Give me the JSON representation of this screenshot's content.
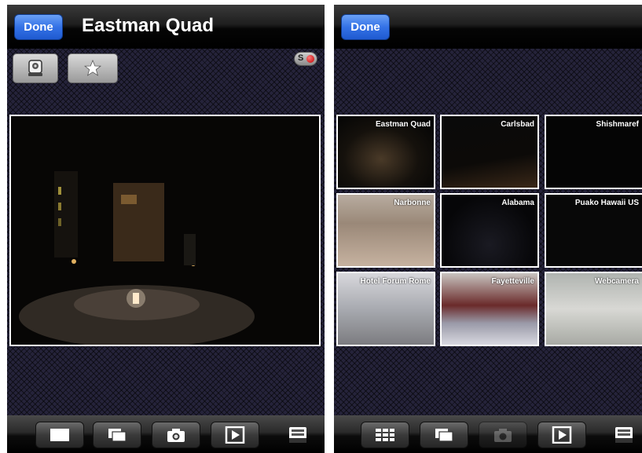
{
  "left_screen": {
    "done_label": "Done",
    "title": "Eastman Quad",
    "buttons": {
      "camera_control_icon": "ptz-camera-icon",
      "favorite_icon": "star-icon",
      "record_label": "S"
    },
    "camera": {
      "name": "Eastman Quad",
      "overlay_text": "..."
    },
    "toolbar": [
      {
        "icon": "single-view-icon"
      },
      {
        "icon": "multi-window-icon"
      },
      {
        "icon": "snapshot-camera-icon"
      },
      {
        "icon": "play-icon"
      },
      {
        "icon": "inbox-icon"
      }
    ]
  },
  "right_screen": {
    "done_label": "Done",
    "thumbnails": [
      {
        "label": "Eastman Quad"
      },
      {
        "label": "Carlsbad"
      },
      {
        "label": "Shishmaref"
      },
      {
        "label": "Narbonne"
      },
      {
        "label": "Alabama"
      },
      {
        "label": "Puako Hawaii US"
      },
      {
        "label": "Hotel Forum Rome"
      },
      {
        "label": "Fayetteville"
      },
      {
        "label": "Webcamera"
      }
    ],
    "toolbar": [
      {
        "icon": "grid-view-icon"
      },
      {
        "icon": "multi-window-icon"
      },
      {
        "icon": "snapshot-camera-icon"
      },
      {
        "icon": "play-icon"
      },
      {
        "icon": "inbox-icon"
      }
    ]
  },
  "colors": {
    "done_button": "#3472e6",
    "record_dot": "#d00000",
    "background_pattern": "#25233a"
  }
}
